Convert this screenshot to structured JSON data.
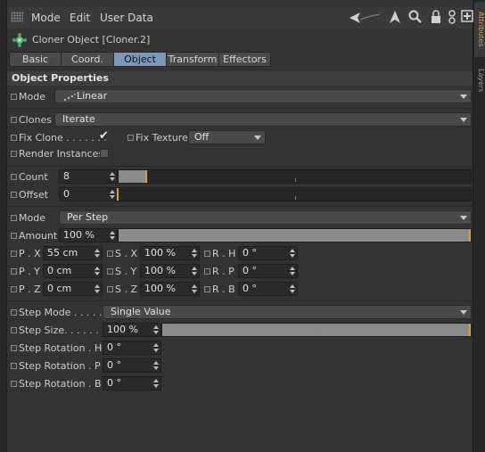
{
  "menu": {
    "mode": "Mode",
    "edit": "Edit",
    "user_data": "User Data"
  },
  "right_tabs": {
    "attributes": "Attributes",
    "layers": "Layers"
  },
  "object": {
    "title": "Cloner Object [Cloner.2]"
  },
  "tabs": [
    "Basic",
    "Coord.",
    "Object",
    "Transform",
    "Effectors"
  ],
  "section_title": "Object Properties",
  "mode": {
    "label": "Mode",
    "value": "Linear"
  },
  "clones": {
    "label": "Clones",
    "value": "Iterate"
  },
  "fix_clone": {
    "label": "Fix Clone . . . . . . .",
    "checked": true,
    "mark": "✔"
  },
  "fix_texture": {
    "label": "Fix Texture",
    "value": "Off"
  },
  "render_instances": {
    "label": "Render Instances",
    "checked": false
  },
  "count": {
    "label": "Count",
    "value": "8",
    "level": 0.08
  },
  "offset": {
    "label": "Offset",
    "value": "0",
    "level": 0.0
  },
  "mode2": {
    "label": "Mode",
    "value": "Per Step"
  },
  "amount": {
    "label": "Amount",
    "value": "100 %",
    "level": 1.0
  },
  "grid": [
    [
      {
        "label": "P . X",
        "value": "55 cm"
      },
      {
        "label": "S . X",
        "value": "100 %"
      },
      {
        "label": "R . H",
        "value": "0 °"
      }
    ],
    [
      {
        "label": "P . Y",
        "value": "0 cm"
      },
      {
        "label": "S . Y",
        "value": "100 %"
      },
      {
        "label": "R . P",
        "value": "0 °"
      }
    ],
    [
      {
        "label": "P . Z",
        "value": "0 cm"
      },
      {
        "label": "S . Z",
        "value": "100 %"
      },
      {
        "label": "R . B",
        "value": "0 °"
      }
    ]
  ],
  "step_mode": {
    "label": "Step Mode . . . . .",
    "value": "Single Value"
  },
  "step_size": {
    "label": "Step Size. . . . . . .",
    "value": "100 %",
    "level": 1.0
  },
  "step_rotation_h": {
    "label": "Step Rotation . H",
    "value": "0 °"
  },
  "step_rotation_p": {
    "label": "Step Rotation . P",
    "value": "0 °"
  },
  "step_rotation_b": {
    "label": "Step Rotation . B",
    "value": "0 °"
  },
  "colors": {
    "accent_tab": "#7c99bd",
    "slider_marker": "#e8a020",
    "slider_fill": "#8b8b8b"
  }
}
